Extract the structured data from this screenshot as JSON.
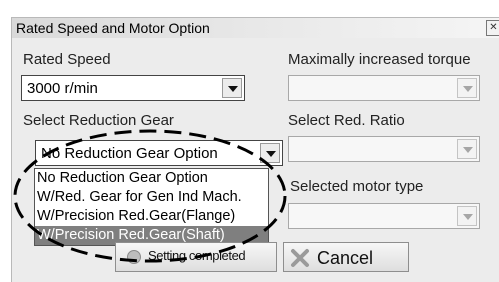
{
  "window": {
    "title": "Rated Speed and Motor Option",
    "close_glyph": "✕"
  },
  "rated_speed": {
    "label": "Rated Speed",
    "value": "3000 r/min"
  },
  "max_torque": {
    "label": "Maximally increased torque",
    "value": ""
  },
  "reduction_gear": {
    "label": "Select Reduction Gear",
    "value": "No Reduction Gear Option",
    "options": [
      "No Reduction Gear Option",
      "W/Red. Gear for Gen Ind Mach.",
      "W/Precision Red.Gear(Flange)",
      "W/Precision Red.Gear(Shaft)"
    ],
    "highlighted_option": "W/Precision Red.Gear(Shaft)"
  },
  "red_ratio": {
    "label": "Select Red. Ratio",
    "value": ""
  },
  "motor_type": {
    "label": "Selected motor type",
    "value": ""
  },
  "buttons": {
    "setting_completed": "Setting completed",
    "cancel": "Cancel"
  },
  "colors": {
    "highlight_bg": "#7f7f7f",
    "cancel_icon": "#9a9a9a",
    "annotation": "#000000"
  }
}
